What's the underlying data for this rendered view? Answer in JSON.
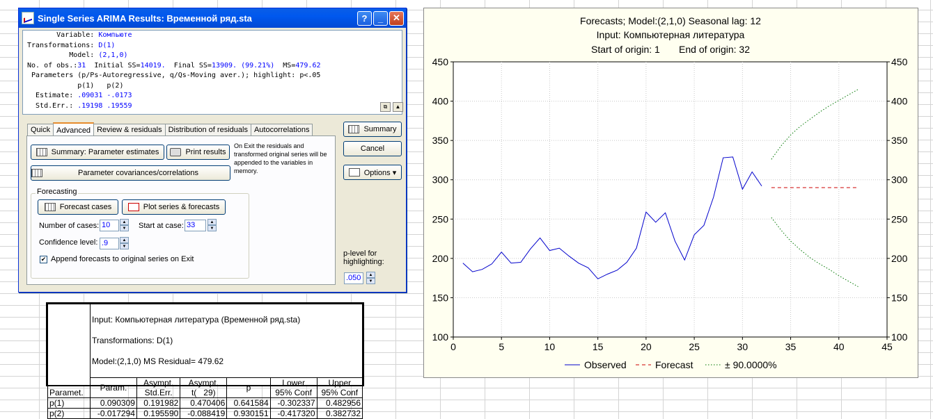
{
  "dialog": {
    "title": "Single Series ARIMA Results: Временной ряд.sta",
    "help_btn": "?",
    "min_btn": "_",
    "close_btn": "✕",
    "results": {
      "variable_label": "       Variable: ",
      "variable_value": "Компьюте",
      "transformations_label": "Transformations: ",
      "transformations_value": "D(1)",
      "model_label": "          Model: ",
      "model_value": "(2,1,0)",
      "obs_label": "No. of obs.:",
      "obs_value": "31",
      "initial_label": "  Initial SS=",
      "initial_value": "14019.",
      "final_label": "  Final SS=",
      "final_value": "13909. (99.21%)",
      "ms_label": "  MS=",
      "ms_value": "479.62",
      "params_line": " Parameters (p/Ps-Autoregressive, q/Qs-Moving aver.); highlight: p<.05",
      "param_headers": "            p(1)   p(2)",
      "estimate_label": "  Estimate: ",
      "estimate_value": ".09031 -.0173",
      "stderr_label": "  Std.Err.: ",
      "stderr_value": ".19198 .19559"
    },
    "tabs": [
      "Quick",
      "Advanced",
      "Review & residuals",
      "Distribution of residuals",
      "Autocorrelations"
    ],
    "active_tab": "Advanced",
    "buttons": {
      "summary_params": "Summary:  Parameter estimates",
      "print_results": "Print results",
      "param_cov": "Parameter covariances/correlations",
      "forecast_cases": "Forecast cases",
      "plot_series": "Plot series & forecasts",
      "summary": "Summary",
      "cancel": "Cancel",
      "options": "Options ▾"
    },
    "exit_note": "On Exit the residuals and transformed original series will be appended to the variables in memory.",
    "forecasting_group": "Forecasting",
    "num_cases_label": "Number of cases:",
    "num_cases_value": "10",
    "start_case_label": "Start at case:",
    "start_case_value": "33",
    "conf_label": "Confidence level:",
    "conf_value": ".9",
    "append_label": "Append forecasts to original series on Exit",
    "append_checked": "✔",
    "plevel_label": "p-level for highlighting:",
    "plevel_value": ".050"
  },
  "table": {
    "header_lines": [
      "Input: Компьютерная литература (Временной ряд.sta)",
      "Transformations: D(1)",
      "Model:(2,1,0) MS Residual= 479.62"
    ],
    "corner": "Paramet.",
    "columns": [
      [
        "Param.",
        ""
      ],
      [
        "Asympt.",
        "Std.Err."
      ],
      [
        "Asympt.",
        "t(   29)"
      ],
      [
        "p",
        ""
      ],
      [
        "Lower",
        "95% Conf"
      ],
      [
        "Upper",
        "95% Conf"
      ]
    ],
    "rows": [
      {
        "name": "p(1)",
        "cells": [
          "0.090309",
          "0.191982",
          "0.470406",
          "0.641584",
          "-0.302337",
          "0.482956"
        ]
      },
      {
        "name": "p(2)",
        "cells": [
          "-0.017294",
          "0.195590",
          "-0.088419",
          "0.930151",
          "-0.417320",
          "0.382732"
        ]
      }
    ]
  },
  "chart_data": {
    "type": "line",
    "title_lines": [
      "Forecasts; Model:(2,1,0) Seasonal lag: 12",
      "Input: Компьютерная литература",
      "Start of origin: 1       End of origin: 32"
    ],
    "xlim": [
      0,
      45
    ],
    "ylim": [
      100,
      450
    ],
    "xticks": [
      0,
      5,
      10,
      15,
      20,
      25,
      30,
      35,
      40,
      45
    ],
    "yticks": [
      100,
      150,
      200,
      250,
      300,
      350,
      400,
      450
    ],
    "grid": true,
    "legend_position": "bottom",
    "series": [
      {
        "name": "Observed",
        "style": "solid",
        "color": "#0000cc",
        "x": [
          1,
          2,
          3,
          4,
          5,
          6,
          7,
          8,
          9,
          10,
          11,
          12,
          13,
          14,
          15,
          16,
          17,
          18,
          19,
          20,
          21,
          22,
          23,
          24,
          25,
          26,
          27,
          28,
          29,
          30,
          31,
          32
        ],
        "y": [
          194,
          183,
          186,
          193,
          208,
          194,
          195,
          212,
          226,
          210,
          213,
          203,
          194,
          188,
          174,
          180,
          185,
          195,
          213,
          259,
          246,
          258,
          222,
          198,
          230,
          242,
          278,
          328,
          329,
          288,
          310,
          292
        ]
      },
      {
        "name": "Forecast",
        "style": "dashed",
        "color": "#cc0000",
        "x": [
          33,
          34,
          35,
          36,
          37,
          38,
          39,
          40,
          41,
          42
        ],
        "y": [
          290,
          290,
          290,
          290,
          290,
          290,
          290,
          290,
          290,
          290
        ]
      },
      {
        "name": "± 90.0000%",
        "style": "dotted",
        "color": "#007700",
        "x": [
          33,
          34,
          35,
          36,
          37,
          38,
          39,
          40,
          41,
          42
        ],
        "y": [
          326,
          343,
          357,
          368,
          377,
          386,
          394,
          401,
          408,
          415
        ]
      },
      {
        "name": "",
        "style": "dotted",
        "color": "#007700",
        "x": [
          33,
          34,
          35,
          36,
          37,
          38,
          39,
          40,
          41,
          42
        ],
        "y": [
          252,
          236,
          222,
          211,
          201,
          193,
          186,
          178,
          171,
          164
        ]
      }
    ]
  }
}
